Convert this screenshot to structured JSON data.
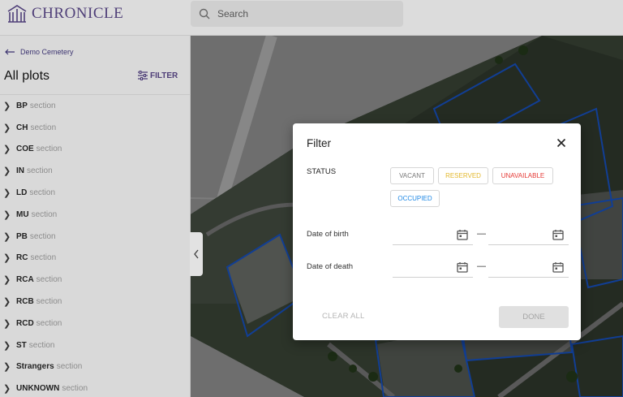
{
  "header": {
    "app_name": "CHRONICLE",
    "search_placeholder": "Search"
  },
  "sidebar": {
    "back_label": "Demo Cemetery",
    "title": "All plots",
    "filter_label": "FILTER",
    "section_word": "section",
    "sections": [
      {
        "code": "BP"
      },
      {
        "code": "CH"
      },
      {
        "code": "COE"
      },
      {
        "code": "IN"
      },
      {
        "code": "LD"
      },
      {
        "code": "MU"
      },
      {
        "code": "PB"
      },
      {
        "code": "RC"
      },
      {
        "code": "RCA"
      },
      {
        "code": "RCB"
      },
      {
        "code": "RCD"
      },
      {
        "code": "ST"
      },
      {
        "code": "Strangers"
      },
      {
        "code": "UNKNOWN"
      }
    ]
  },
  "filter_modal": {
    "title": "Filter",
    "status_label": "STATUS",
    "statuses": [
      {
        "label": "VACANT",
        "color": "#777777"
      },
      {
        "label": "RESERVED",
        "color": "#e3b82d"
      },
      {
        "label": "UNAVAILABLE",
        "color": "#e53935"
      },
      {
        "label": "OCCUPIED",
        "color": "#1e88e5"
      }
    ],
    "date_of_birth_label": "Date of birth",
    "date_of_death_label": "Date of death",
    "range_separator": "—",
    "clear_label": "CLEAR ALL",
    "done_label": "DONE"
  },
  "colors": {
    "brand": "#4f3f78",
    "plot_outline": "#1e6bff"
  }
}
